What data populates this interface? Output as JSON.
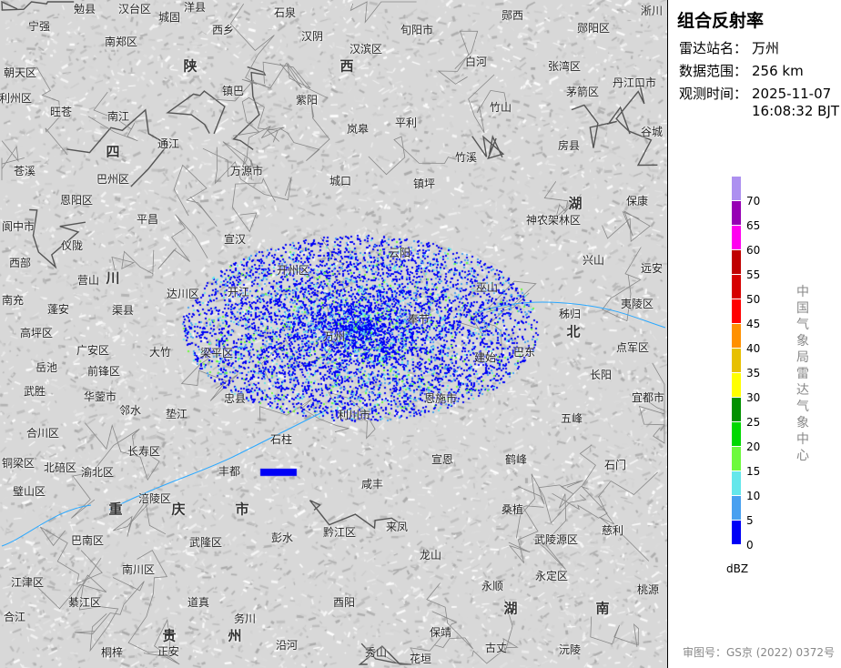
{
  "panel": {
    "title": "组合反射率",
    "station_label": "雷达站名：",
    "station": "万州",
    "range_label": "数据范围：",
    "range": "256 km",
    "time_label": "观测时间：",
    "date": "2025-11-07",
    "time": "16:08:32 BJT",
    "unit": "dBZ",
    "org": "中国气象局雷达气象中心",
    "review": "审图号：GS京 (2022) 0372号"
  },
  "legend": {
    "ticks": [
      "0",
      "5",
      "10",
      "15",
      "20",
      "25",
      "30",
      "35",
      "40",
      "45",
      "50",
      "55",
      "60",
      "65",
      "70"
    ],
    "colors": [
      "#0000f6",
      "#48a0f0",
      "#64e7eb",
      "#6dfa3d",
      "#00d800",
      "#019000",
      "#ffff00",
      "#e7c000",
      "#ff9000",
      "#ff0000",
      "#d60000",
      "#c00000",
      "#ff00f0",
      "#9600b4",
      "#ad90f0"
    ]
  },
  "map": {
    "labels": [
      "勉县",
      "汉台区",
      "城固",
      "洋县",
      "石泉",
      "旬阳市",
      "郧西",
      "淅川",
      "宁强",
      "西乡",
      "汉阴",
      "汉滨区",
      "郧阳区",
      "南郑区",
      "陕",
      "西",
      "白河",
      "张湾区",
      "朝天区",
      "镇巴",
      "紫阳",
      "丹江口市",
      "利州区",
      "旺苍",
      "南江",
      "岚皋",
      "平利",
      "竹山",
      "茅箭区",
      "谷城",
      "四",
      "通江",
      "房县",
      "竹溪",
      "苍溪",
      "巴州区",
      "万源市",
      "城口",
      "镇坪",
      "恩阳区",
      "保康",
      "阆中市",
      "平昌",
      "湖",
      "神农架林区",
      "仪陇",
      "宣汉",
      "兴山",
      "西部",
      "营山",
      "川",
      "达川区",
      "开江",
      "巫山",
      "远安",
      "南充",
      "蓬安",
      "渠县",
      "奉节",
      "秭归",
      "夷陵区",
      "高坪区",
      "大竹",
      "梁平区",
      "北",
      "点军区",
      "广安区",
      "前锋区",
      "建始",
      "巴东",
      "岳池",
      "长阳",
      "武胜",
      "华蓥市",
      "邻水",
      "忠县",
      "恩施市",
      "宜都市",
      "垫江",
      "利川市",
      "五峰",
      "合川区",
      "石柱",
      "长寿区",
      "鹤峰",
      "铜梁区",
      "北碚区",
      "渝北区",
      "宣恩",
      "石门",
      "丰都",
      "璧山区",
      "重",
      "涪陵区",
      "庆",
      "市",
      "咸丰",
      "桑植",
      "巴南区",
      "武隆区",
      "彭水",
      "黔江区",
      "来凤",
      "武陵源区",
      "慈利",
      "江津区",
      "南川区",
      "龙山",
      "永定区",
      "永顺",
      "桃源",
      "綦江区",
      "道真",
      "酉阳",
      "湖",
      "南",
      "合江",
      "务川",
      "桐梓",
      "贵",
      "州",
      "正安",
      "沿河",
      "秀山",
      "保靖",
      "花垣",
      "古丈",
      "沅陵",
      "万州",
      "开州区",
      "云阳"
    ]
  }
}
